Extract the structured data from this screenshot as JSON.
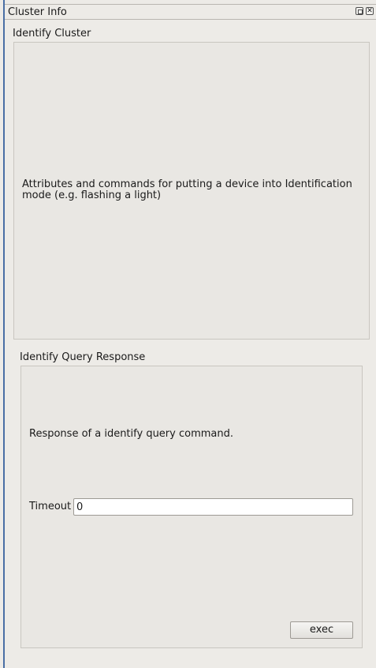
{
  "dock": {
    "title": "Cluster Info",
    "buttons": {
      "float_icon": "float-icon",
      "close_icon": "close-icon",
      "close_glyph": "✕"
    }
  },
  "identify_cluster": {
    "title": "Identify Cluster",
    "description": "Attributes and commands for putting a device into Identification mode (e.g. flashing a light)"
  },
  "identify_query_response": {
    "title": "Identify Query Response",
    "description": "Response of a identify query command.",
    "timeout_label": "Timeout",
    "timeout_value": "0",
    "exec_label": "exec"
  },
  "colors": {
    "background": "#edebe7",
    "frame": "#e9e7e3",
    "accent_edge": "#4a6fa5"
  }
}
